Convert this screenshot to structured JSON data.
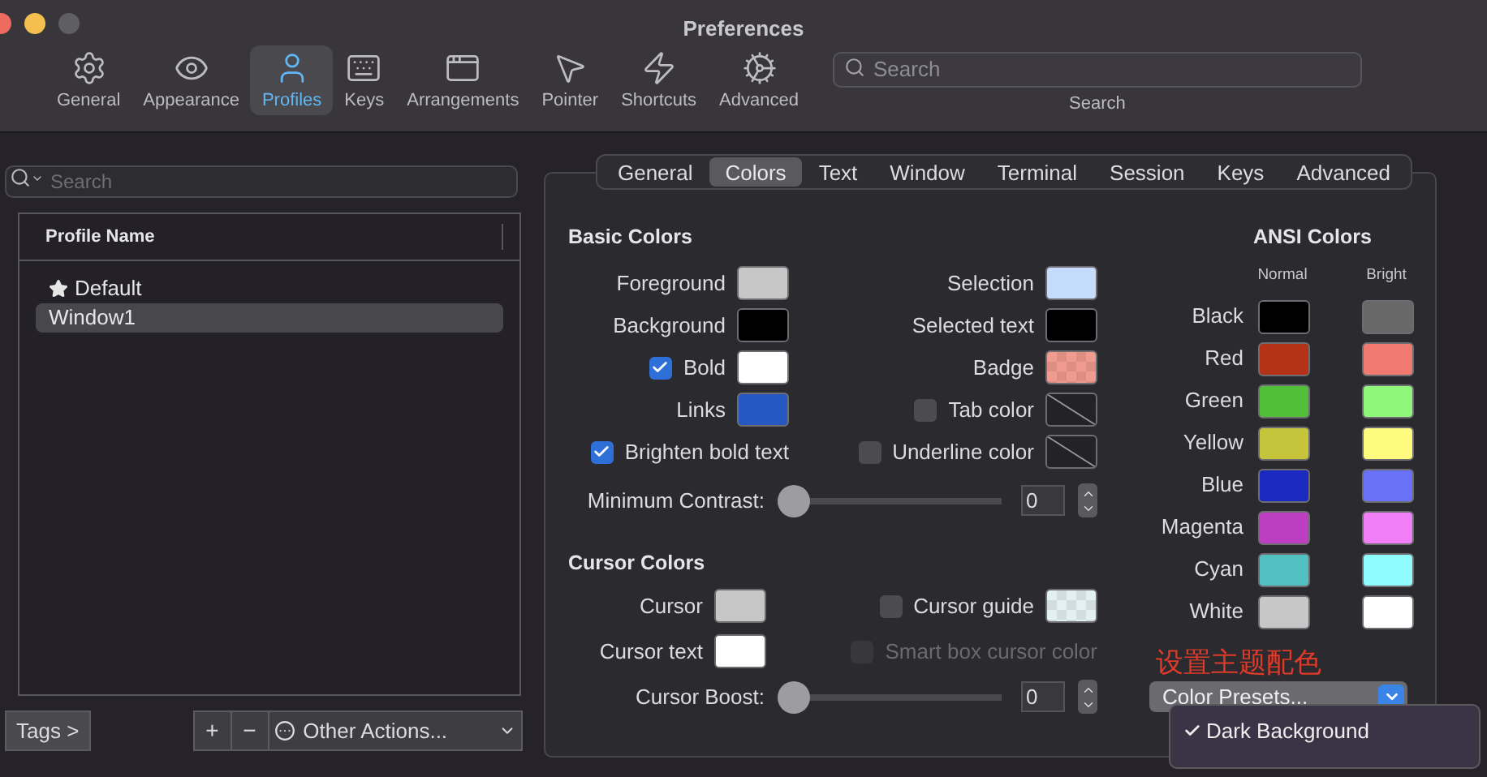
{
  "window": {
    "title": "Preferences"
  },
  "toolbar": [
    {
      "label": "General",
      "selected": false
    },
    {
      "label": "Appearance",
      "selected": false
    },
    {
      "label": "Profiles",
      "selected": true
    },
    {
      "label": "Keys",
      "selected": false
    },
    {
      "label": "Arrangements",
      "selected": false
    },
    {
      "label": "Pointer",
      "selected": false
    },
    {
      "label": "Shortcuts",
      "selected": false
    },
    {
      "label": "Advanced",
      "selected": false
    }
  ],
  "search": {
    "placeholder": "Search",
    "label": "Search"
  },
  "profiles": {
    "search_placeholder": "Search",
    "column": "Profile Name",
    "items": [
      {
        "name": "Default",
        "starred": true,
        "selected": false
      },
      {
        "name": "Window1",
        "starred": false,
        "selected": true
      }
    ],
    "tags_button": "Tags >",
    "add_button": "+",
    "remove_button": "−",
    "actions_menu": "Other Actions..."
  },
  "tabs": [
    {
      "label": "General",
      "selected": false
    },
    {
      "label": "Colors",
      "selected": true
    },
    {
      "label": "Text",
      "selected": false
    },
    {
      "label": "Window",
      "selected": false
    },
    {
      "label": "Terminal",
      "selected": false
    },
    {
      "label": "Session",
      "selected": false
    },
    {
      "label": "Keys",
      "selected": false
    },
    {
      "label": "Advanced",
      "selected": false
    }
  ],
  "basic_colors": {
    "title": "Basic Colors",
    "left": [
      {
        "label": "Foreground",
        "swatch": {
          "kind": "solid",
          "color": "#c7c7c7"
        }
      },
      {
        "label": "Background",
        "swatch": {
          "kind": "solid",
          "color": "#000000"
        }
      },
      {
        "label": "Bold",
        "checked": true,
        "swatch": {
          "kind": "solid",
          "color": "#ffffff"
        }
      },
      {
        "label": "Links",
        "swatch": {
          "kind": "solid",
          "color": "#2558c0"
        }
      },
      {
        "label": "Brighten bold text",
        "checked": true
      }
    ],
    "right": [
      {
        "label": "Selection",
        "swatch": {
          "kind": "solid",
          "color": "#c6dcfc"
        }
      },
      {
        "label": "Selected text",
        "swatch": {
          "kind": "solid",
          "color": "#000000"
        }
      },
      {
        "label": "Badge",
        "swatch": {
          "kind": "checker",
          "color": "#f19a8e"
        }
      },
      {
        "label": "Tab color",
        "checked": false,
        "swatch": {
          "kind": "none"
        }
      },
      {
        "label": "Underline color",
        "checked": false,
        "swatch": {
          "kind": "none"
        }
      }
    ],
    "minimum_contrast": {
      "label": "Minimum Contrast:",
      "level": 0,
      "value": "0"
    }
  },
  "cursor_colors": {
    "title": "Cursor Colors",
    "left": [
      {
        "label": "Cursor",
        "swatch": {
          "kind": "solid",
          "color": "#c7c7c7"
        }
      },
      {
        "label": "Cursor text",
        "swatch": {
          "kind": "solid",
          "color": "#ffffff"
        }
      }
    ],
    "right": [
      {
        "label": "Cursor guide",
        "checked": false,
        "swatch": {
          "kind": "checker",
          "color": "#e3f0f4"
        }
      },
      {
        "label": "Smart box cursor color",
        "checked": false,
        "disabled": true
      }
    ],
    "boost": {
      "label": "Cursor Boost:",
      "level": 0,
      "value": "0"
    }
  },
  "ansi": {
    "title": "ANSI Colors",
    "columns": [
      "Normal",
      "Bright"
    ],
    "rows": [
      {
        "name": "Black",
        "normal": {
          "color": "#000000"
        },
        "bright": {
          "color": "#686868"
        }
      },
      {
        "name": "Red",
        "normal": {
          "color": "#b43218"
        },
        "bright": {
          "color": "#f07a70"
        }
      },
      {
        "name": "Green",
        "normal": {
          "color": "#51bf37"
        },
        "bright": {
          "color": "#8ef77a"
        }
      },
      {
        "name": "Yellow",
        "normal": {
          "color": "#c6c43a"
        },
        "bright": {
          "color": "#fefb7e"
        }
      },
      {
        "name": "Blue",
        "normal": {
          "color": "#1a2ac0"
        },
        "bright": {
          "color": "#6871f7"
        }
      },
      {
        "name": "Magenta",
        "normal": {
          "color": "#bb3fc0"
        },
        "bright": {
          "color": "#f07ef7"
        }
      },
      {
        "name": "Cyan",
        "normal": {
          "color": "#52c1c1"
        },
        "bright": {
          "color": "#8ffdfe"
        }
      },
      {
        "name": "White",
        "normal": {
          "color": "#c7c7c7"
        },
        "bright": {
          "color": "#ffffff"
        }
      }
    ]
  },
  "annotation": "设置主题配色",
  "presets": {
    "label": "Color Presets...",
    "menu": [
      {
        "label": "Dark Background",
        "checked": true
      }
    ]
  }
}
